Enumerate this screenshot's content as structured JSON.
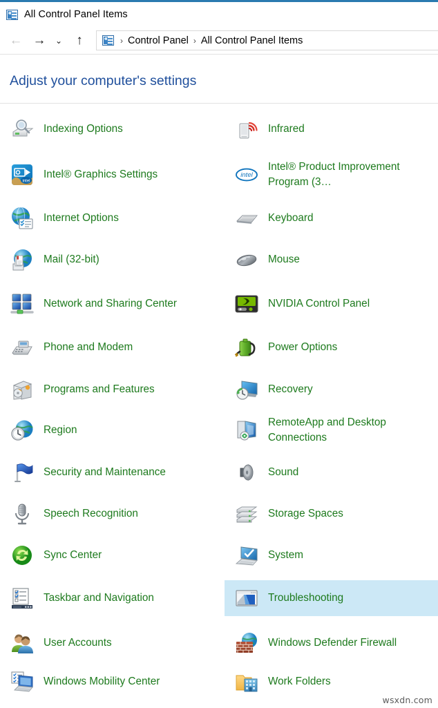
{
  "window": {
    "title": "All Control Panel Items",
    "title_icon": "control-panel-icon"
  },
  "nav": {
    "back_label": "←",
    "forward_label": "→",
    "recent_label": "⌄",
    "up_label": "↑",
    "back_enabled": false,
    "forward_enabled": true
  },
  "breadcrumb": {
    "icon": "control-panel-icon",
    "separator": "›",
    "crumbs": [
      "Control Panel",
      "All Control Panel Items"
    ]
  },
  "page": {
    "heading": "Adjust your computer's settings"
  },
  "colors": {
    "accent_bar": "#2a7ab0",
    "heading_blue": "#1f4f9c",
    "item_label_green": "#1d7a1d",
    "selection_blue": "#cce8f6",
    "separator_gray": "#e2e2e2"
  },
  "items": [
    {
      "label": "Indexing Options",
      "icon": "indexing-options-icon",
      "column": "left",
      "selected": false
    },
    {
      "label": "Infrared",
      "icon": "infrared-icon",
      "column": "right",
      "selected": false
    },
    {
      "label": "Intel® Graphics Settings",
      "icon": "intel-graphics-icon",
      "column": "left",
      "selected": false
    },
    {
      "label": "Intel® Product Improvement Program (3…",
      "icon": "intel-logo-icon",
      "column": "right",
      "selected": false
    },
    {
      "label": "Internet Options",
      "icon": "internet-options-icon",
      "column": "left",
      "selected": false
    },
    {
      "label": "Keyboard",
      "icon": "keyboard-icon",
      "column": "right",
      "selected": false
    },
    {
      "label": "Mail (32-bit)",
      "icon": "mail-icon",
      "column": "left",
      "selected": false
    },
    {
      "label": "Mouse",
      "icon": "mouse-icon",
      "column": "right",
      "selected": false
    },
    {
      "label": "Network and Sharing Center",
      "icon": "network-sharing-icon",
      "column": "left",
      "selected": false
    },
    {
      "label": "NVIDIA Control Panel",
      "icon": "nvidia-icon",
      "column": "right",
      "selected": false
    },
    {
      "label": "Phone and Modem",
      "icon": "phone-modem-icon",
      "column": "left",
      "selected": false
    },
    {
      "label": "Power Options",
      "icon": "power-options-icon",
      "column": "right",
      "selected": false
    },
    {
      "label": "Programs and Features",
      "icon": "programs-features-icon",
      "column": "left",
      "selected": false
    },
    {
      "label": "Recovery",
      "icon": "recovery-icon",
      "column": "right",
      "selected": false
    },
    {
      "label": "Region",
      "icon": "region-icon",
      "column": "left",
      "selected": false
    },
    {
      "label": "RemoteApp and Desktop Connections",
      "icon": "remoteapp-icon",
      "column": "right",
      "selected": false
    },
    {
      "label": "Security and Maintenance",
      "icon": "security-maintenance-icon",
      "column": "left",
      "selected": false
    },
    {
      "label": "Sound",
      "icon": "sound-icon",
      "column": "right",
      "selected": false
    },
    {
      "label": "Speech Recognition",
      "icon": "speech-recognition-icon",
      "column": "left",
      "selected": false
    },
    {
      "label": "Storage Spaces",
      "icon": "storage-spaces-icon",
      "column": "right",
      "selected": false
    },
    {
      "label": "Sync Center",
      "icon": "sync-center-icon",
      "column": "left",
      "selected": false
    },
    {
      "label": "System",
      "icon": "system-icon",
      "column": "right",
      "selected": false
    },
    {
      "label": "Taskbar and Navigation",
      "icon": "taskbar-navigation-icon",
      "column": "left",
      "selected": false
    },
    {
      "label": "Troubleshooting",
      "icon": "troubleshooting-icon",
      "column": "right",
      "selected": true
    },
    {
      "label": "User Accounts",
      "icon": "user-accounts-icon",
      "column": "left",
      "selected": false
    },
    {
      "label": "Windows Defender Firewall",
      "icon": "windows-defender-firewall-icon",
      "column": "right",
      "selected": false
    },
    {
      "label": "Windows Mobility Center",
      "icon": "windows-mobility-center-icon",
      "column": "left",
      "selected": false
    },
    {
      "label": "Work Folders",
      "icon": "work-folders-icon",
      "column": "right",
      "selected": false
    }
  ],
  "watermark": {
    "text": "wsxdn.com"
  }
}
